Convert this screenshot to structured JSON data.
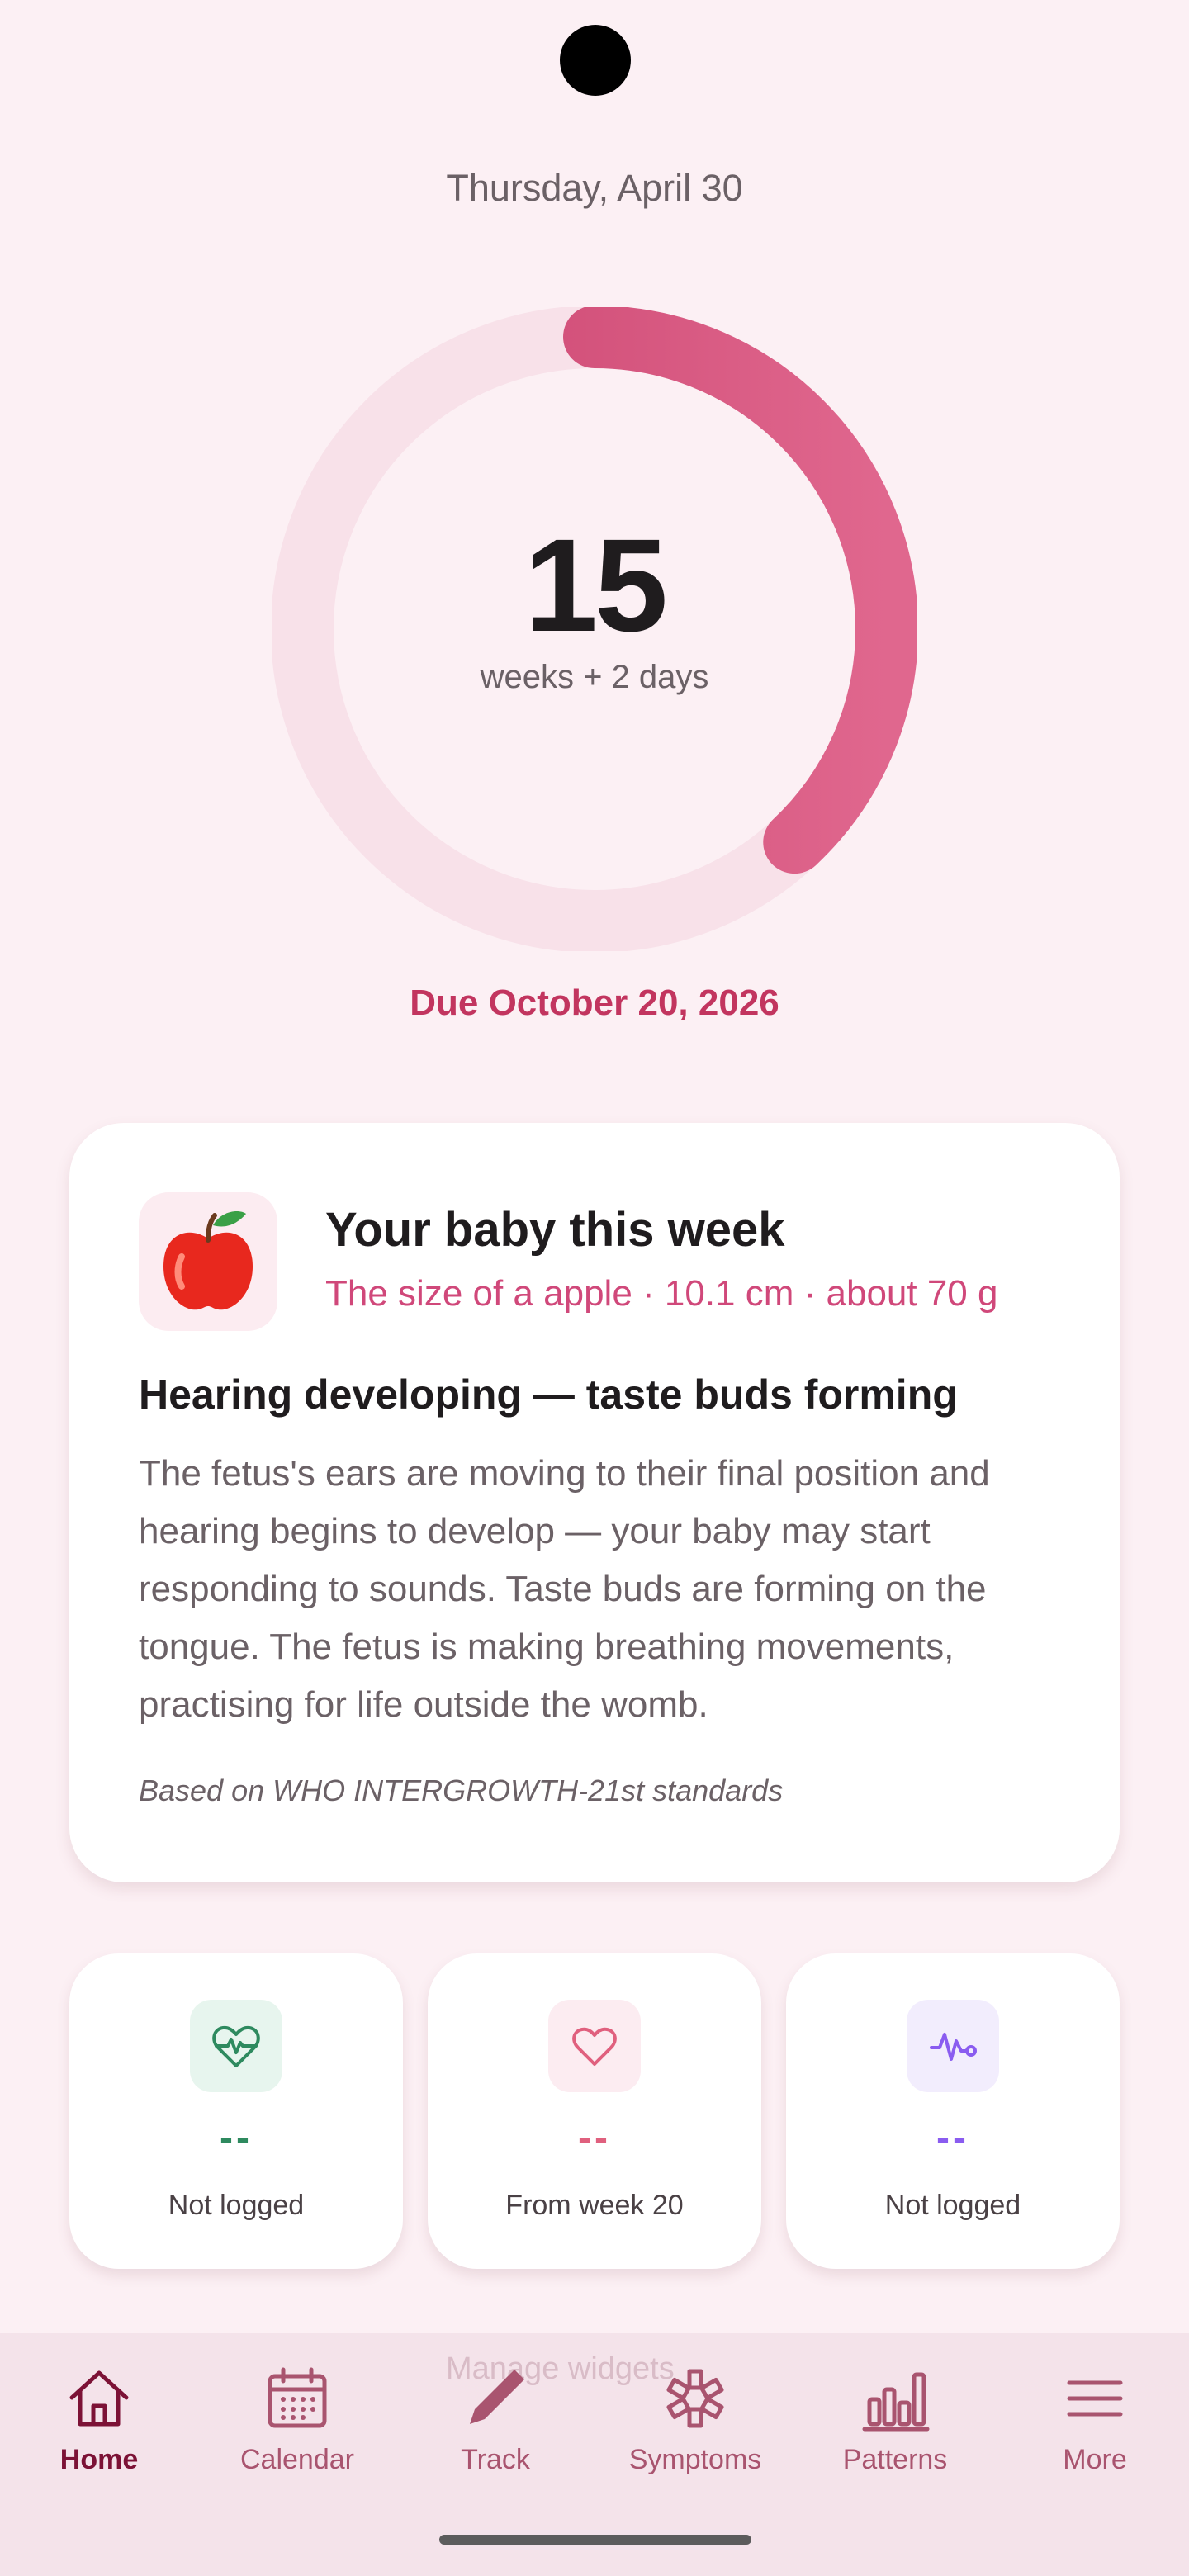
{
  "header": {
    "date": "Thursday, April 30"
  },
  "progress": {
    "weeks": "15",
    "sub_label": "weeks + 2 days",
    "due": "Due October 20, 2026",
    "fraction": 0.38
  },
  "baby_card": {
    "icon": "apple-emoji",
    "title": "Your baby this week",
    "size_line": "The size of a apple · 10.1 cm · about 70 g",
    "headline": "Hearing developing — taste buds forming",
    "body": "The fetus's ears are moving to their final position and hearing begins to develop — your baby may start responding to sounds. Taste buds are forming on the tongue. The fetus is making breathing movements, practising for life outside the womb.",
    "source": "Based on WHO INTERGROWTH-21st standards"
  },
  "stats": [
    {
      "icon": "heart-pulse-icon",
      "value": "--",
      "label": "Not logged",
      "color": "#2e8a5f"
    },
    {
      "icon": "heart-icon",
      "value": "--",
      "label": "From week 20",
      "color": "#e0607e"
    },
    {
      "icon": "activity-icon",
      "value": "--",
      "label": "Not logged",
      "color": "#8a5cf0"
    }
  ],
  "manage_widgets": "Manage widgets",
  "nav": [
    {
      "icon": "home-icon",
      "label": "Home",
      "active": true
    },
    {
      "icon": "calendar-icon",
      "label": "Calendar"
    },
    {
      "icon": "pencil-icon",
      "label": "Track"
    },
    {
      "icon": "symptoms-icon",
      "label": "Symptoms"
    },
    {
      "icon": "bar-chart-icon",
      "label": "Patterns"
    },
    {
      "icon": "menu-icon",
      "label": "More"
    }
  ],
  "colors": {
    "accent": "#c2355f",
    "ring_track": "#f8e1e9",
    "background": "#fcf0f4"
  }
}
